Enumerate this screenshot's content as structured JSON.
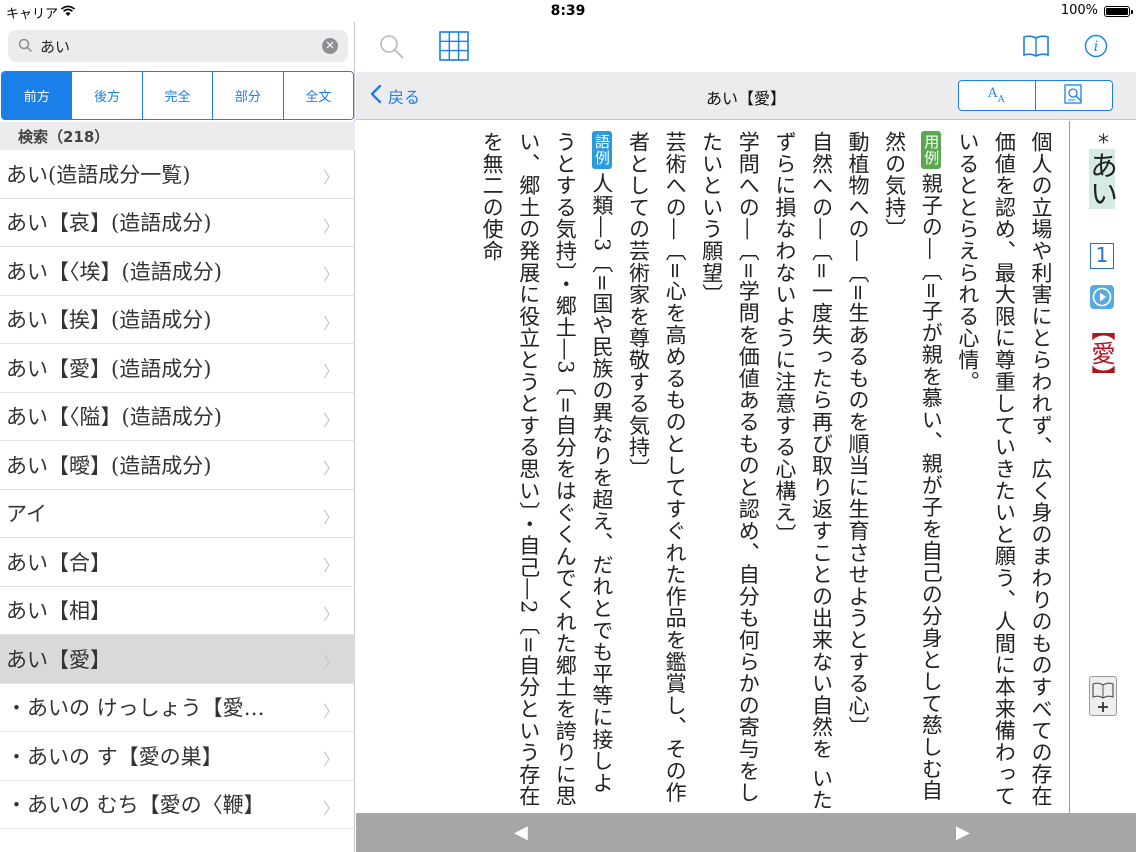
{
  "status_bar": {
    "carrier": "キャリア",
    "time": "8:39",
    "battery": "100%"
  },
  "search": {
    "value": "あい",
    "placeholder": ""
  },
  "search_modes": [
    "前方",
    "後方",
    "完全",
    "部分",
    "全文"
  ],
  "search_modes_active": "前方",
  "results_header": "検索（218）",
  "results": [
    {
      "label": "あい(造語成分一覧)",
      "selected": false
    },
    {
      "label": "あい【哀】(造語成分)",
      "selected": false
    },
    {
      "label": "あい【〈埃】(造語成分)",
      "selected": false
    },
    {
      "label": "あい【挨】(造語成分)",
      "selected": false
    },
    {
      "label": "あい【愛】(造語成分)",
      "selected": false
    },
    {
      "label": "あい【〈隘】(造語成分)",
      "selected": false
    },
    {
      "label": "あい【曖】(造語成分)",
      "selected": false
    },
    {
      "label": "アイ",
      "selected": false
    },
    {
      "label": "あい【合】",
      "selected": false
    },
    {
      "label": "あい【相】",
      "selected": false
    },
    {
      "label": "あい【愛】",
      "selected": true
    },
    {
      "label": "・あいの けっしょう【愛…",
      "selected": false
    },
    {
      "label": "・あいの す【愛の巣】",
      "selected": false
    },
    {
      "label": "・あいの むち【愛の〈鞭】",
      "selected": false
    }
  ],
  "navbar": {
    "back_label": "戻る",
    "title": "あい【愛】",
    "font_button": "AA"
  },
  "entry": {
    "definition": "個人の立場や利害にとらわれず、広く身のまわりのものすべての存在価値を認め、最大限に尊重していきたいと願う、人間に本来備わっているととらえられる心情。",
    "usage_tag": "用例",
    "usage_lines": [
      "親子の―〔=子が親を慕い、親が子を自己の分身として慈しむ自然の気持〕",
      "動植物への―〔=生あるものを順当に生育させようとする心〕",
      "自然への―〔=一度失ったら再び取り返すことの出来ない自然を いたずらに損なわないように注意する心構え〕",
      "学問への―〔=学問を価値あるものと認め、自分も何らかの寄与をしたいという願望〕",
      "芸術への―〔=心を高めるものとしてすぐれた作品を鑑賞し、その作者としての芸術家を尊敬する気持〕"
    ],
    "example_tag": "語例",
    "example_lines": [
      "人類―3〔=国や民族の異なりを超え、だれとでも平等に接しようとする気持〕・郷土―3〔=自分をはぐくんでくれた郷土を誇りに思い、郷土の発展に役立とうとする思い〕・自己―2〔=自分という存在を無二の使命"
    ]
  },
  "index": {
    "star": "*",
    "headword": "あい",
    "sense_number": "1",
    "kanji": "【愛】"
  },
  "colors": {
    "accent": "#1a7fe8",
    "selected_row": "#d9d9d9",
    "usage_tag": "#5aa84f",
    "example_tag": "#2a9bdc"
  },
  "icons": [
    "search-icon",
    "grid-icon",
    "book-icon",
    "info-icon",
    "chevron-left-icon",
    "font-size-icon",
    "search-in-page-icon",
    "play-icon",
    "add-bookmark-icon",
    "triangle-left-icon",
    "triangle-right-icon"
  ]
}
